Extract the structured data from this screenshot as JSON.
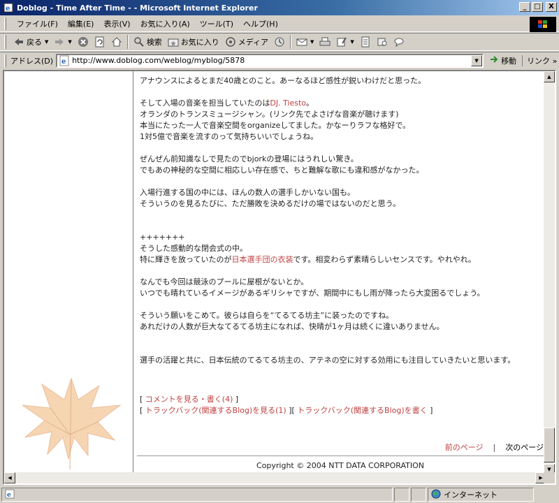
{
  "window": {
    "title": "Doblog - Time After Time - - Microsoft Internet Explorer",
    "minimize": "_",
    "maximize": "□",
    "close": "X"
  },
  "menu": [
    "ファイル(F)",
    "編集(E)",
    "表示(V)",
    "お気に入り(A)",
    "ツール(T)",
    "ヘルプ(H)"
  ],
  "toolbar": {
    "back": "戻る",
    "search": "検索",
    "favorites": "お気に入り",
    "media": "メディア"
  },
  "address": {
    "label": "アドレス(D)",
    "url": "http://www.doblog.com/weblog/myblog/5878",
    "go": "移動",
    "links": "リンク"
  },
  "content": {
    "p1": [
      "アナウンスによるとまだ40歳とのこと。あーなるほど感性が鋭いわけだと思った。"
    ],
    "p2_pre": "そして入場の音楽を担当していたのは",
    "p2_link": "DJ. Tiesto",
    "p2_post": "。",
    "p2_lines": [
      "オランダのトランスミュージシャン。(リンク先でよさげな音楽が聴けます)",
      "本当にたった一人で音楽空間をorganizeしてました。かなーりラフな格好で。",
      "1対5億で音楽を流すのって気持ちいいでしょうね。"
    ],
    "p3": [
      "ぜんぜん前知識なしで見たのでbjorkの登場にはうれしい驚き。",
      "でもあの神秘的な空間に相応しい存在感で、ちと難解な歌にも違和感がなかった。"
    ],
    "p4": [
      "入場行進する国の中には、ほんの数人の選手しかいない国も。",
      "そういうのを見るたびに、ただ勝敗を決めるだけの場ではないのだと思う。"
    ],
    "p5_line1": "+++++++",
    "p5_line2": "そうした感動的な閉会式の中。",
    "p5_pre": "特に輝きを放っていたのが",
    "p5_link": "日本選手団の衣装",
    "p5_post": "です。相変わらず素晴らしいセンスです。やれやれ。",
    "p6": [
      "なんでも今回は競泳のプールに屋根がないとか。",
      "いつでも晴れているイメージがあるギリシャですが、期間中にもし雨が降ったら大変困るでしょう。"
    ],
    "p7": [
      "そういう願いをこめて。彼らは自らを“てるてる坊主”に装ったのですね。",
      "あれだけの人数が巨大なてるてる坊主になれば、快晴が1ヶ月は続くに違いありません。"
    ],
    "p8": "選手の活躍と共に、日本伝統のてるてる坊主の、アテネの空に対する効用にも注目していきたいと思います。",
    "comments_link": "コメントを見る・書く(4)",
    "trackback_view": "トラックバック(関連するBlog)を見る(1)",
    "trackback_write": "トラックバック(関連するBlog)を書く"
  },
  "nav": {
    "prev": "前のページ",
    "separator": "|",
    "next": "次のページ"
  },
  "footer": {
    "copyright": "Copyright © 2004 NTT DATA CORPORATION"
  },
  "status": {
    "zone": "インターネット"
  },
  "colors": {
    "link": "#c04040",
    "title_gradient_start": "#0a246a",
    "title_gradient_end": "#a6caf0"
  }
}
